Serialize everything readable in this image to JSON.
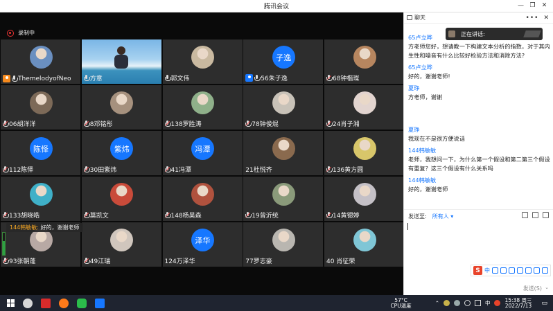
{
  "window": {
    "title": "腾讯会议"
  },
  "recording": {
    "label": "录制中"
  },
  "tiles": [
    {
      "name": "ThemelodyofNeo",
      "avatar": "photo",
      "color": "#6a8fc0",
      "mic": "on",
      "host": "orange"
    },
    {
      "name": "方意",
      "avatar": "video",
      "mic": "on"
    },
    {
      "name": "郭文伟",
      "avatar": "photo",
      "color": "#c9b9a0",
      "mic": "on"
    },
    {
      "name": "56朱子逸",
      "avatar": "text",
      "avatar_text": "子逸",
      "mic": "on",
      "host": "blue"
    },
    {
      "name": "68钟楷璨",
      "avatar": "photo",
      "color": "#b7865f",
      "mic": "off"
    },
    {
      "name": "06胡洋洋",
      "avatar": "photo",
      "color": "#7d6a58",
      "mic": "off"
    },
    {
      "name": "8邓铭彤",
      "avatar": "photo",
      "color": "#a6917e",
      "mic": "off"
    },
    {
      "name": "138罗胜涛",
      "avatar": "photo",
      "color": "#8fb08a",
      "mic": "off"
    },
    {
      "name": "78钟俊焜",
      "avatar": "photo",
      "color": "#c8c2b8",
      "mic": "off"
    },
    {
      "name": "24肖子湘",
      "avatar": "photo",
      "color": "#e2d4cf",
      "mic": "off"
    },
    {
      "name": "112陈怿",
      "avatar": "text",
      "avatar_text": "陈怿",
      "mic": "off"
    },
    {
      "name": "30田紫炜",
      "avatar": "text",
      "avatar_text": "紫炜",
      "mic": "off"
    },
    {
      "name": "41冯潭",
      "avatar": "text",
      "avatar_text": "冯潭",
      "mic": "off"
    },
    {
      "name": "21杜悦齐",
      "avatar": "photo",
      "color": "#8a6a4e",
      "mic": "none"
    },
    {
      "name": "136黄方圆",
      "avatar": "photo",
      "color": "#d8c66a",
      "mic": "off"
    },
    {
      "name": "133胡晓皓",
      "avatar": "photo",
      "color": "#3fb0c8",
      "mic": "off"
    },
    {
      "name": "莫凯文",
      "avatar": "photo",
      "color": "#c94b3a",
      "mic": "off"
    },
    {
      "name": "148杨昊森",
      "avatar": "photo",
      "color": "#b0523e",
      "mic": "off"
    },
    {
      "name": "19曾沂统",
      "avatar": "photo",
      "color": "#8a9a7a",
      "mic": "off"
    },
    {
      "name": "14黄锶婷",
      "avatar": "photo",
      "color": "#c4c0c6",
      "mic": "off"
    },
    {
      "name": "93张朝蓬",
      "avatar": "photo",
      "color": "#b8a9a4",
      "mic": "off"
    },
    {
      "name": "49江瑞",
      "avatar": "photo",
      "color": "#d0c6bd",
      "mic": "off"
    },
    {
      "name": "124万泽华",
      "avatar": "text",
      "avatar_text": "泽华",
      "mic": "none"
    },
    {
      "name": "77罗志豪",
      "avatar": "photo",
      "color": "#b9b6b0",
      "mic": "none"
    },
    {
      "name": "40 肖征荣",
      "avatar": "photo",
      "color": "#7fc6d6",
      "mic": "none"
    }
  ],
  "chat_bubble": {
    "who": "144韩敏敏:",
    "text": "好的，谢谢老师"
  },
  "chat": {
    "title": "聊天",
    "more": "•••",
    "close": "✕",
    "speaking_label": "正在讲话:",
    "messages": [
      {
        "sender": "65卢立晔",
        "lines": [
          "方老师您好，想请教一下构建文本分析的指数，对于其内",
          "生性和噪音有什么比较好检验方法和消除方法?"
        ]
      },
      {
        "sender": "65卢立晔",
        "lines": [
          "好的，谢谢老师!"
        ]
      },
      {
        "sender": "夏琤",
        "lines": [
          "方老师，谢谢"
        ]
      },
      {
        "sender": "",
        "lines": [
          ""
        ]
      },
      {
        "sender": "夏琤",
        "lines": [
          "我现在不是很方便说话"
        ]
      },
      {
        "sender": "144韩敏敏",
        "lines": [
          "老师，我想问一下，为什么第一个假设和第二第三个假设",
          "有重复？这三个假设有什么关系吗"
        ]
      },
      {
        "sender": "144韩敏敏",
        "lines": [
          "好的，谢谢老师"
        ]
      }
    ],
    "send_to_label": "发送至:",
    "send_to_target": "所有人",
    "send_label": "发送(S)"
  },
  "ime": {
    "label": "中"
  },
  "taskbar": {
    "temp": "57°C",
    "temp_label": "CPU温度",
    "time": "15:38 周三",
    "date": "2022/7/13"
  }
}
